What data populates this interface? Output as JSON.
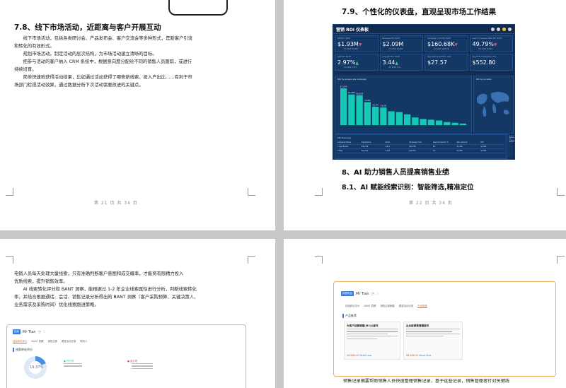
{
  "page1": {
    "heading": "7.8、线下市场活动，近距离与客户开展互动",
    "lines": [
      "线下市场活动，包括各类研讨会、产品发布会、客户交流会等多种形式，是新客户引流",
      "和转化的有效形式。",
      "规划市场活动，制定活动的层次结构，为市场活动建立清晰的目标。",
      "把参与活动的客户纳入 CRM 系统中，根据意向度分配给不同的销售人员跟踪，或进行",
      "持续培育。",
      "简单快速地获得活动结果，比如通过活动获得了哪些新线索、投入产出比……有利于市",
      "场部门检视活动效果，通过数据分析下次活动需要改进的关键点。"
    ],
    "footer": "第 21 页 共 34 页"
  },
  "page2": {
    "heading": "7.9、个性化的仪表盘，直观呈现市场工作结果",
    "dashboard": {
      "title": "营销 ROI 仪表板",
      "kpis": [
        {
          "label": "ROI Nov 2018",
          "value": "$1.93M",
          "sub": "Oct 2018: $1.89M",
          "trend": "down"
        },
        {
          "label": "Revenue Nov 2018",
          "value": "$2.09M",
          "sub": "Oct 2018: $2.04M",
          "trend": "none"
        },
        {
          "label": "Campaign Cost Nov 2018",
          "value": "$160.68K",
          "sub": "Oct 2018: $155.29K",
          "trend": "down"
        },
        {
          "label": "Lead Conversion Rate Nov 2018",
          "value": "49.79%",
          "sub": "Oct 2018: 48.85%",
          "trend": "down"
        },
        {
          "label": "CTR Nov 2018",
          "value": "2.97%",
          "sub": "Oct 2018: 2.74%",
          "trend": "up"
        },
        {
          "label": "Avg CPC Nov 2018",
          "value": "3.44",
          "sub": "Oct 2018: 3.31",
          "trend": "up"
        },
        {
          "label": "Avg Lead Acquisition Cost",
          "value": "$27.57",
          "sub": "",
          "trend": "none"
        },
        {
          "label": "Avg Deal Acquisition Cost",
          "value": "$552.80",
          "sub": "",
          "trend": "none"
        }
      ],
      "panel_a_title": "ROI by Google Ads Campaign",
      "panel_b_title": "ROI by Location",
      "panel_c_title": "ROI Overview",
      "panel_d_title": "Invested Amount vs Closed Amount",
      "table_headers": [
        "Campaign Name",
        "Impressions",
        "Clicks",
        "Campaign Cost",
        "Lead Conversion %",
        "Won Amount",
        "ROI"
      ],
      "table_rows": [
        [
          "1  App Builder",
          "249,796",
          "2,611",
          "$16,768",
          "8%",
          "$1,26K",
          "$1,26K"
        ],
        [
          "2  Blog",
          "316,733",
          "3,218",
          "$19,352",
          "5%",
          "$1,83K",
          "$1,45K"
        ]
      ],
      "bars": [
        24,
        20,
        19.5,
        15,
        12,
        11.5,
        9,
        8.5,
        7,
        5,
        4,
        3.5,
        3,
        2,
        1.5,
        1
      ],
      "bar_color": "#16c9b5",
      "bar_labels": [
        "$7.22M",
        "$6.40M",
        "$6.02M",
        "$4.6M",
        "$3.7M",
        "$3.5M"
      ]
    },
    "heading2": "8、AI 助力销售人员提高销售业绩",
    "heading3": "8.1、AI 赋能线索识别：智能筛选,精准定位",
    "footer": "第 22 页 共 34 页"
  },
  "page3": {
    "lines": [
      "电销人员每天处理大量线索，只有准确判断客户意图和成交概率，才能将有限精力投入",
      "优质线索，提升销售效率。",
      "AI 线索转化评分和 BANT 洞察，能根据过 1-2 年企业线索属性进行分析，判断线索转化",
      "率，并结合根据通话、会话、销售记录分析得出的 BANT 洞察（客户采购预算、关键决策人、",
      "业务需求及采购时间）优化线索跟进策略。"
    ],
    "crm": {
      "name": "Mr Tian",
      "tag": "线索",
      "tabs": [
        "线索转化评分",
        "BANT 洞察",
        "销售过程",
        "跟进活动记录",
        "联系人"
      ],
      "panel_title": "线索转化评分",
      "score": "19.37%",
      "items": [
        "低分项",
        "高分项"
      ]
    }
  },
  "page4": {
    "crm": {
      "name": "Mr Tian",
      "tag": "销售机会",
      "tabs": [
        "线索转化评分",
        "BANT 洞察",
        "销售过程摘要",
        "跟进活动记录",
        "产品推荐"
      ],
      "section": "产品推荐",
      "products": [
        {
          "title": "大客户经营管理(MCA)套件",
          "price": "¥8,888.00",
          "link": "Read Less"
        },
        {
          "title": "企业级销售管理套件",
          "price": "¥8,888.00",
          "link": "Read Less"
        }
      ]
    },
    "bottom_line": "销售记录摘要帮助销售人员快速整理销售记录，基于这些记录，销售管理者针对关键线"
  }
}
